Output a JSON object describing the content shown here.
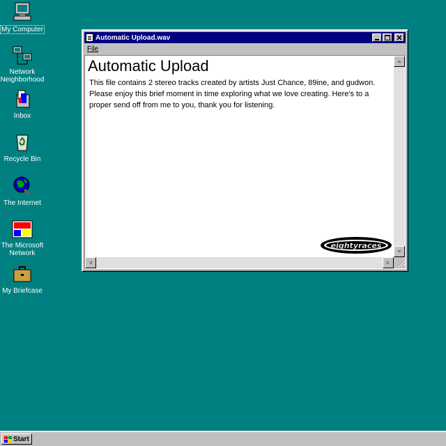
{
  "desktop": {
    "icons": [
      {
        "label": "My Computer",
        "icon": "computer-icon"
      },
      {
        "label": "Network Neighborhood",
        "icon": "network-icon"
      },
      {
        "label": "Inbox",
        "icon": "inbox-icon"
      },
      {
        "label": "Recycle Bin",
        "icon": "recycle-bin-icon"
      },
      {
        "label": "The Internet",
        "icon": "internet-icon"
      },
      {
        "label": "The Microsoft Network",
        "icon": "msn-icon"
      },
      {
        "label": "My Briefcase",
        "icon": "briefcase-icon"
      }
    ]
  },
  "window": {
    "title": "Automatic Upload.wav",
    "menu": [
      "File"
    ],
    "heading": "Automatic Upload",
    "body": "This file contains 2 stereo tracks created by artists Just Chance, 89ine, and gudwon. Please enjoy this brief moment in time exploring what we love creating. Here's to a proper send off from me to you, thank you for listening.",
    "logo_text": "eightyraces"
  },
  "taskbar": {
    "start_label": "Start"
  },
  "colors": {
    "desktop": "#008080",
    "titlebar": "#000080",
    "chrome": "#c0c0c0"
  }
}
